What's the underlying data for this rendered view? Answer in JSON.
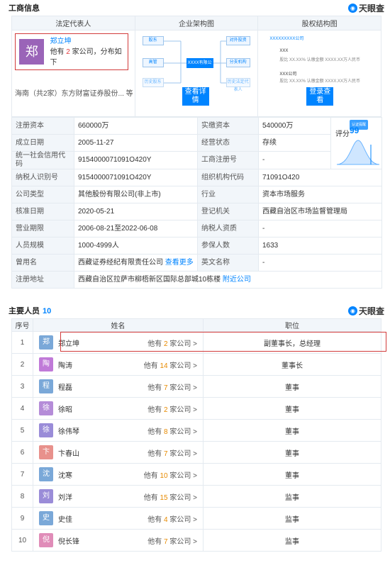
{
  "biz": {
    "title": "工商信息",
    "logo": "天眼查",
    "panel_headers": [
      "法定代表人",
      "企业架构图",
      "股权结构图"
    ],
    "legal_rep": {
      "avatar_char": "郑",
      "name": "郑立坤",
      "desc_prefix": "他有",
      "company_count": "2",
      "desc_suffix": "家公司，分布如下",
      "more": "海南（共2家）东方财富证券股份...  等"
    },
    "diagram": {
      "center": "XXXX有限公司",
      "nodes": [
        "股东",
        "高管",
        "历史股东",
        "对外投资",
        "分支机构",
        "历史法定代表人"
      ],
      "button": "查看详情"
    },
    "equity": {
      "lines": [
        "XXXXXXXXX公司",
        "XXX",
        "股比 XX.XX% 认缴金额 XXXX.XX万人民币",
        "XXX公司",
        "股比 XX.XX% 认缴金额 XXXX.XX万人民币"
      ],
      "button": "登录查看"
    },
    "rows": [
      {
        "l1": "注册资本",
        "v1": "660000万",
        "l2": "实缴资本",
        "v2": "540000万"
      },
      {
        "l1": "成立日期",
        "v1": "2005-11-27",
        "l2": "经营状态",
        "v2": "存续"
      },
      {
        "l1": "统一社会信用代码",
        "v1": "9154000071091O420Y",
        "l2": "工商注册号",
        "v2": "-"
      },
      {
        "l1": "纳税人识别号",
        "v1": "9154000071091O420Y",
        "l2": "组织机构代码",
        "v2": "71091O420"
      },
      {
        "l1": "公司类型",
        "v1": "其他股份有限公司(非上市)",
        "l2": "行业",
        "v2": "资本市场服务"
      },
      {
        "l1": "核准日期",
        "v1": "2020-05-21",
        "l2": "登记机关",
        "v2": "西藏自治区市场监督管理局"
      },
      {
        "l1": "营业期限",
        "v1": "2006-08-21至2022-06-08",
        "l2": "纳税人资质",
        "v2": "-"
      },
      {
        "l1": "人员规模",
        "v1": "1000-4999人",
        "l2": "参保人数",
        "v2": "1633"
      }
    ],
    "former_name": {
      "label": "曾用名",
      "value": "西藏证券经纪有限责任公司",
      "link": "查看更多",
      "label2": "英文名称",
      "value2": "-"
    },
    "address": {
      "label": "注册地址",
      "value": "西藏自治区拉萨市柳梧新区国际总部城10栋楼",
      "link": "附近公司"
    },
    "score": {
      "label": "评分",
      "value": "99",
      "badge": "认证提醒"
    }
  },
  "people": {
    "title": "主要人员",
    "count": "10",
    "logo": "天眼查",
    "headers": [
      "序号",
      "姓名",
      "职位"
    ],
    "rows": [
      {
        "idx": "1",
        "char": "郑",
        "name": "郑立坤",
        "cnt": "2",
        "pos": "副董事长，总经理",
        "color": "#7aa8d8"
      },
      {
        "idx": "2",
        "char": "陶",
        "name": "陶涛",
        "cnt": "14",
        "pos": "董事长",
        "color": "#c07ad8"
      },
      {
        "idx": "3",
        "char": "程",
        "name": "程磊",
        "cnt": "7",
        "pos": "董事",
        "color": "#7aa8d8"
      },
      {
        "idx": "4",
        "char": "徐",
        "name": "徐昭",
        "cnt": "2",
        "pos": "董事",
        "color": "#b58cd8"
      },
      {
        "idx": "5",
        "char": "徐",
        "name": "徐伟琴",
        "cnt": "8",
        "pos": "董事",
        "color": "#9a8cd8"
      },
      {
        "idx": "6",
        "char": "卞",
        "name": "卞春山",
        "cnt": "7",
        "pos": "董事",
        "color": "#e8918c"
      },
      {
        "idx": "7",
        "char": "沈",
        "name": "沈寒",
        "cnt": "10",
        "pos": "董事",
        "color": "#7aa8d8"
      },
      {
        "idx": "8",
        "char": "刘",
        "name": "刘洋",
        "cnt": "15",
        "pos": "监事",
        "color": "#9a8cd8"
      },
      {
        "idx": "9",
        "char": "史",
        "name": "史佳",
        "cnt": "4",
        "pos": "监事",
        "color": "#7aa8d8"
      },
      {
        "idx": "10",
        "char": "倪",
        "name": "倪长锋",
        "cnt": "7",
        "pos": "监事",
        "color": "#e08cb8"
      }
    ],
    "co_prefix": "他有",
    "co_suffix": "家公司 >"
  }
}
